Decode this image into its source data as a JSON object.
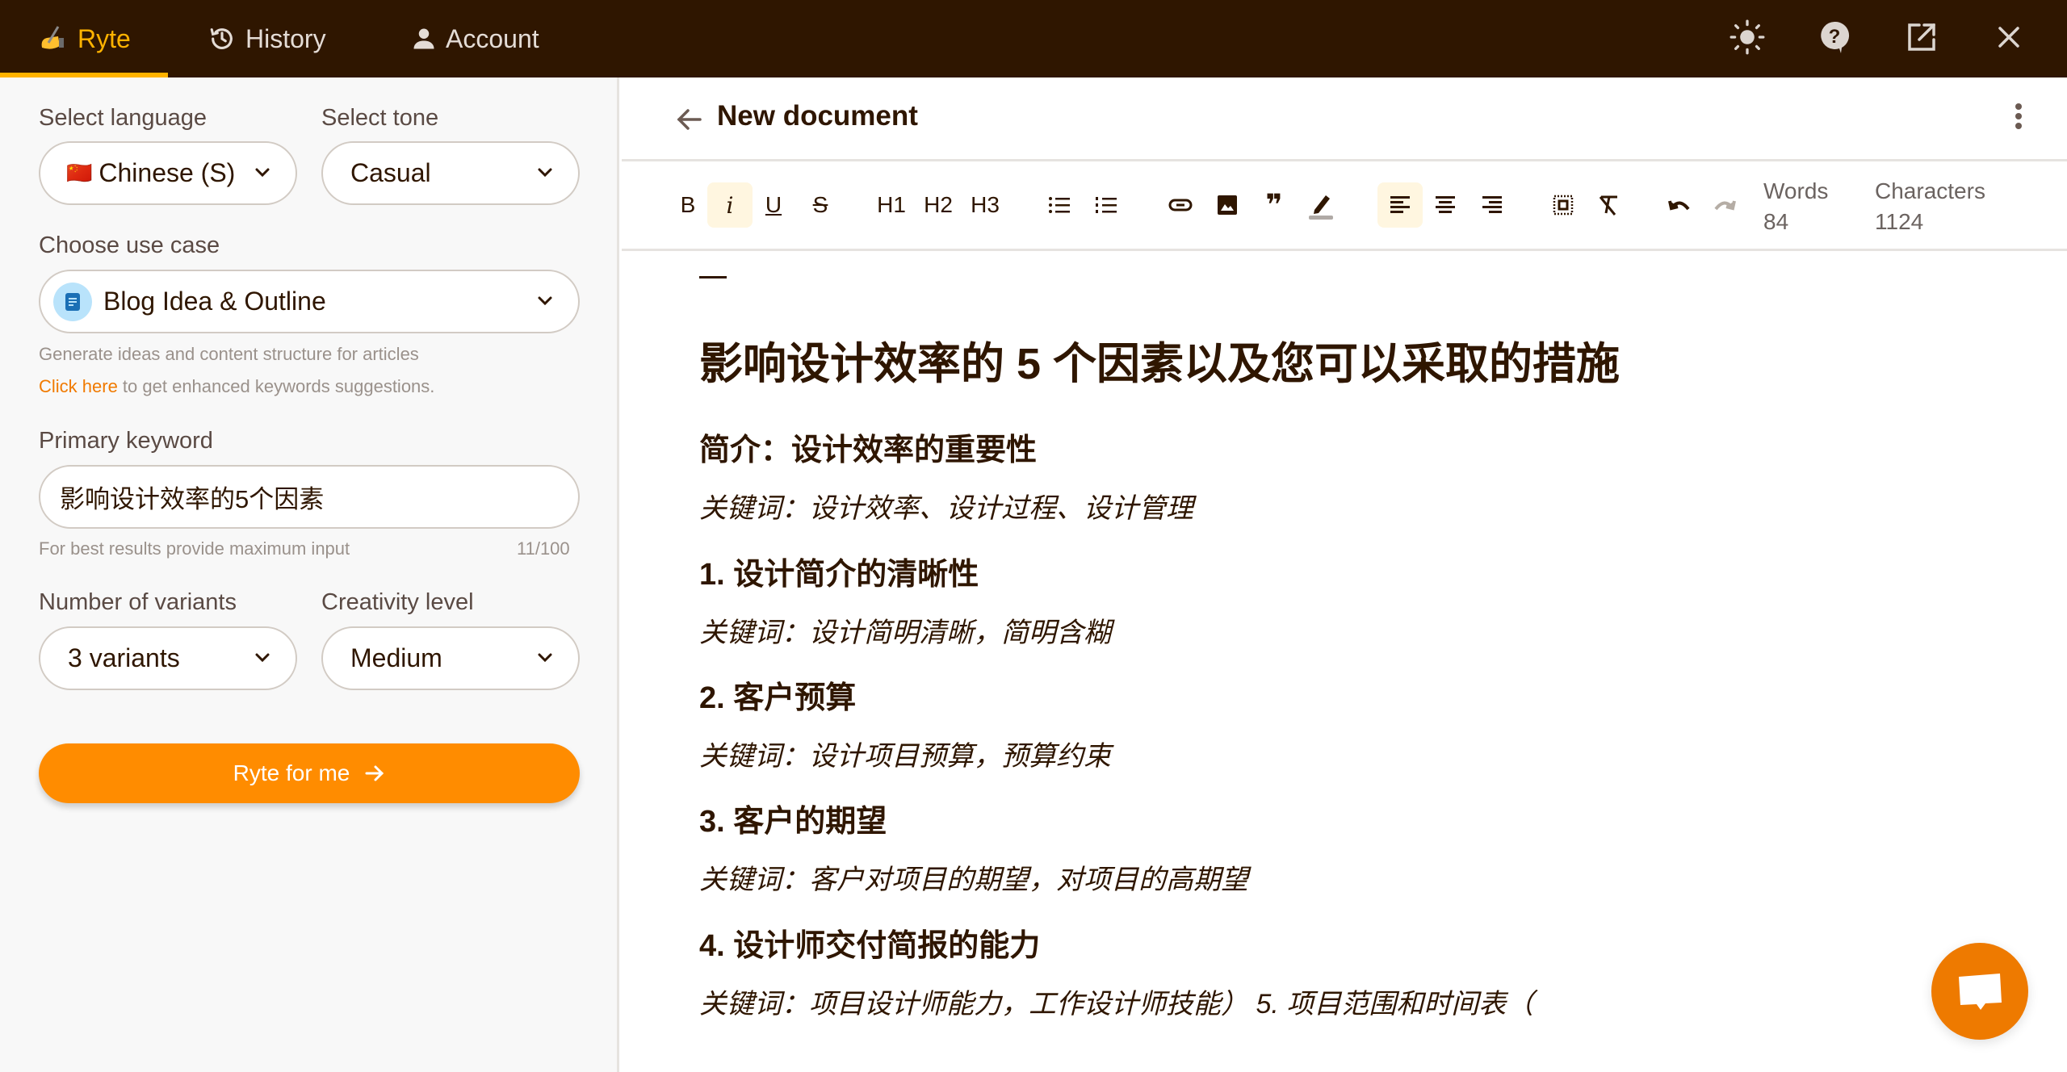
{
  "topbar": {
    "tabs": [
      {
        "label": "Ryte",
        "icon": "writing-hand-icon",
        "active": true
      },
      {
        "label": "History",
        "icon": "history-icon",
        "active": false
      },
      {
        "label": "Account",
        "icon": "person-icon",
        "active": false
      }
    ],
    "actions": [
      "sun-icon",
      "help-icon",
      "open-external-icon",
      "close-icon"
    ]
  },
  "form": {
    "language": {
      "label": "Select language",
      "value": "Chinese (S)",
      "flag": "🇨🇳"
    },
    "tone": {
      "label": "Select tone",
      "value": "Casual"
    },
    "use_case": {
      "label": "Choose use case",
      "value": "Blog Idea & Outline",
      "description": "Generate ideas and content structure for articles",
      "link_text": "Click here",
      "link_suffix": " to get enhanced keywords suggestions."
    },
    "keyword": {
      "label": "Primary keyword",
      "value": "影响设计效率的5个因素",
      "hint": "For best results provide maximum input",
      "counter": "11/100"
    },
    "variants": {
      "label": "Number of variants",
      "value": "3 variants"
    },
    "creativity": {
      "label": "Creativity level",
      "value": "Medium"
    },
    "submit_label": "Ryte for me"
  },
  "document": {
    "title": "New document",
    "toolbar": {
      "bold": "B",
      "italic": "i",
      "underline": "U",
      "strike": "S",
      "h1": "H1",
      "h2": "H2",
      "h3": "H3",
      "words_label": "Words",
      "words_value": "84",
      "chars_label": "Characters",
      "chars_value": "1124"
    },
    "content": {
      "h1": "影响设计效率的 5 个因素以及您可以采取的措施",
      "sections": [
        {
          "heading": "简介：设计效率的重要性",
          "keywords": "关键词：设计效率、设计过程、设计管理"
        },
        {
          "heading": "1. 设计简介的清晰性",
          "keywords": "关键词：设计简明清晰，简明含糊"
        },
        {
          "heading": "2. 客户预算",
          "keywords": "关键词：设计项目预算，预算约束"
        },
        {
          "heading": "3. 客户的期望",
          "keywords": "关键词：客户对项目的期望，对项目的高期望"
        },
        {
          "heading": "4. 设计师交付简报的能力",
          "keywords": "关键词：项目设计师能力，工作设计师技能） 5. 项目范围和时间表（"
        }
      ]
    }
  },
  "colors": {
    "topbar": "#2f1600",
    "accent": "#ffb300",
    "cta": "#ff8c00",
    "chat_fab": "#ee7a00",
    "text": "#2f1600"
  }
}
